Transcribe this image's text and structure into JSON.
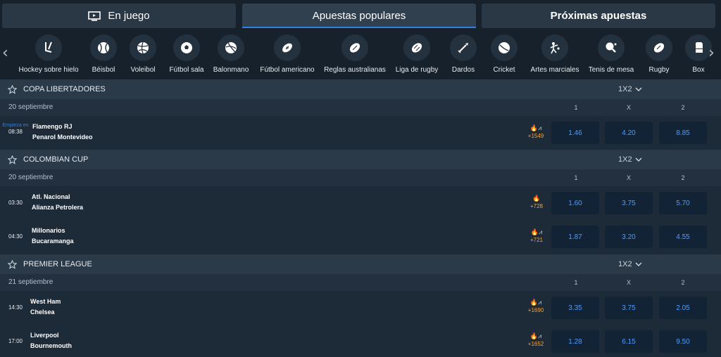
{
  "tabs": [
    {
      "label": "En juego",
      "icon": "tv-icon"
    },
    {
      "label": "Apuestas populares",
      "active": true
    },
    {
      "label": "Próximas apuestas"
    }
  ],
  "sports": [
    {
      "label": "Hockey sobre hielo",
      "icon": "hockey-stick-icon"
    },
    {
      "label": "Béisbol",
      "icon": "baseball-icon"
    },
    {
      "label": "Voleibol",
      "icon": "volleyball-icon"
    },
    {
      "label": "Fútbol sala",
      "icon": "soccer-ball-icon"
    },
    {
      "label": "Balonmano",
      "icon": "handball-icon"
    },
    {
      "label": "Fútbol americano",
      "icon": "american-football-icon"
    },
    {
      "label": "Reglas australianas",
      "icon": "aussie-rules-ball-icon"
    },
    {
      "label": "Liga de rugby",
      "icon": "rugby-league-ball-icon"
    },
    {
      "label": "Dardos",
      "icon": "dart-icon"
    },
    {
      "label": "Cricket",
      "icon": "cricket-ball-icon"
    },
    {
      "label": "Artes marciales",
      "icon": "martial-arts-icon"
    },
    {
      "label": "Tenis de mesa",
      "icon": "table-tennis-icon"
    },
    {
      "label": "Rugby",
      "icon": "rugby-ball-icon"
    },
    {
      "label": "Box",
      "icon": "boxing-glove-icon"
    }
  ],
  "market": "1X2",
  "columns": [
    "1",
    "X",
    "2"
  ],
  "leagues": [
    {
      "name": "COPA LIBERTADORES",
      "date": "20 septiembre",
      "matches": [
        {
          "starts": "Empieza en",
          "time": "08:38",
          "home": "Flamengo RJ",
          "away": "Penarol Montevideo",
          "more": "+1549",
          "chart": true,
          "odds": [
            "1.46",
            "4.20",
            "8.85"
          ]
        }
      ]
    },
    {
      "name": "COLOMBIAN CUP",
      "date": "20 septiembre",
      "matches": [
        {
          "time": "03:30",
          "home": "Atl. Nacional",
          "away": "Alianza Petrolera",
          "more": "+728",
          "chart": false,
          "odds": [
            "1.60",
            "3.75",
            "5.70"
          ]
        },
        {
          "time": "04:30",
          "home": "Millonarios",
          "away": "Bucaramanga",
          "more": "+721",
          "chart": true,
          "odds": [
            "1.87",
            "3.20",
            "4.55"
          ]
        }
      ]
    },
    {
      "name": "PREMIER LEAGUE",
      "date": "21 septiembre",
      "matches": [
        {
          "time": "14:30",
          "home": "West Ham",
          "away": "Chelsea",
          "more": "+1690",
          "chart": true,
          "odds": [
            "3.35",
            "3.75",
            "2.05"
          ]
        },
        {
          "time": "17:00",
          "home": "Liverpool",
          "away": "Bournemouth",
          "more": "+1652",
          "chart": true,
          "odds": [
            "1.28",
            "6.15",
            "9.50"
          ]
        }
      ]
    }
  ],
  "colors": {
    "accent": "#2f7fe0",
    "odds_text": "#4e9bff",
    "fire": "#f4a23c"
  }
}
